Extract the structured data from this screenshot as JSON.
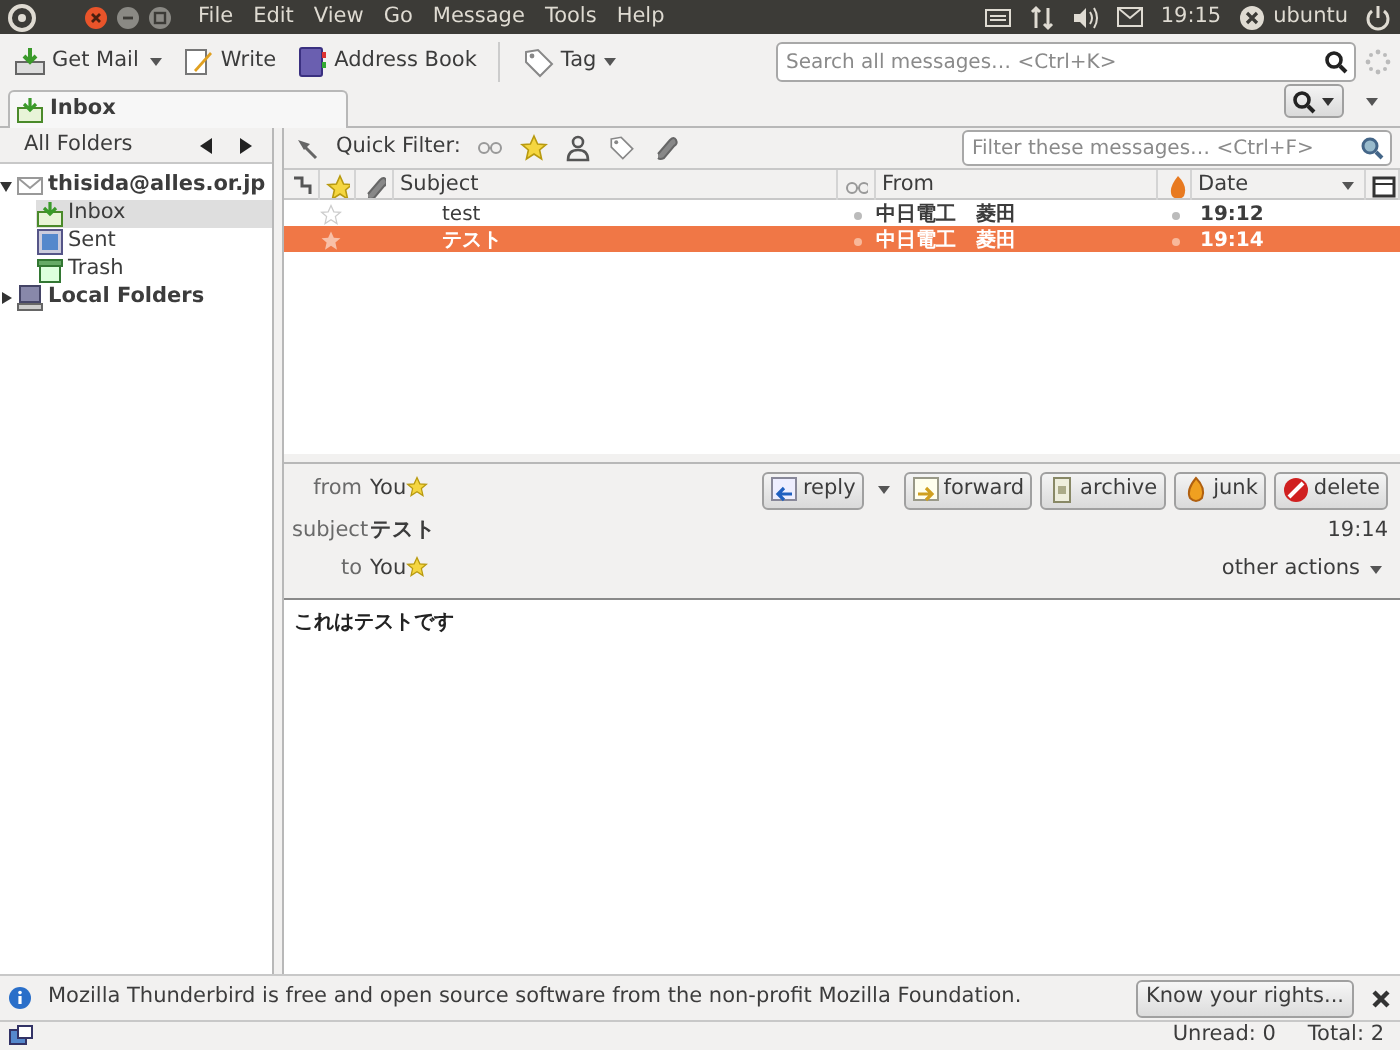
{
  "top_panel": {
    "menus": [
      "File",
      "Edit",
      "View",
      "Go",
      "Message",
      "Tools",
      "Help"
    ],
    "clock": "19:15",
    "user": "ubuntu"
  },
  "toolbar": {
    "buttons": [
      {
        "label": "Get Mail",
        "dropdown": true
      },
      {
        "label": "Write",
        "dropdown": false
      },
      {
        "label": "Address Book",
        "dropdown": false
      },
      {
        "label": "Tag",
        "dropdown": true
      }
    ],
    "search": {
      "placeholder": "Search all messages… <Ctrl+K>"
    }
  },
  "tabs": [
    {
      "label": "Inbox",
      "selected": true
    }
  ],
  "folder_pane": {
    "header": "All Folders",
    "tree": [
      {
        "label": "thisida@alles.or.jp",
        "kind": "account",
        "expanded": true,
        "selected": false,
        "children": [
          {
            "label": "Inbox",
            "kind": "inbox",
            "selected": true
          },
          {
            "label": "Sent",
            "kind": "sent",
            "selected": false
          },
          {
            "label": "Trash",
            "kind": "trash",
            "selected": false
          }
        ]
      },
      {
        "label": "Local Folders",
        "kind": "local",
        "expanded": false,
        "selected": false
      }
    ]
  },
  "quick_filter": {
    "label": "Quick Filter:",
    "placeholder": "Filter these messages… <Ctrl+F>"
  },
  "message_list": {
    "columns": [
      "Subject",
      "From",
      "Date"
    ],
    "rows": [
      {
        "subject": "test",
        "from": "中日電工　菱田",
        "date": "19:12",
        "selected": false
      },
      {
        "subject": "テスト",
        "from": "中日電工　菱田",
        "date": "19:14",
        "selected": true
      }
    ]
  },
  "message_header": {
    "actions": [
      {
        "label": "reply",
        "dropdown": true
      },
      {
        "label": "forward",
        "dropdown": false
      },
      {
        "label": "archive",
        "dropdown": false
      },
      {
        "label": "junk",
        "dropdown": false
      },
      {
        "label": "delete",
        "dropdown": false
      }
    ],
    "fields": [
      {
        "label": "from",
        "value": "You",
        "kind": "person"
      },
      {
        "label": "subject",
        "value": "テスト",
        "kind": "subject"
      },
      {
        "label": "to",
        "value": "You",
        "kind": "person"
      }
    ],
    "date": "19:14",
    "other_actions": "other actions"
  },
  "body": "これはテストです",
  "notification": {
    "text": "Mozilla Thunderbird is free and open source software from the non-profit Mozilla Foundation.",
    "button": "Know your rights..."
  },
  "status_bar": {
    "unread": "Unread: 0",
    "total": "Total: 2"
  }
}
